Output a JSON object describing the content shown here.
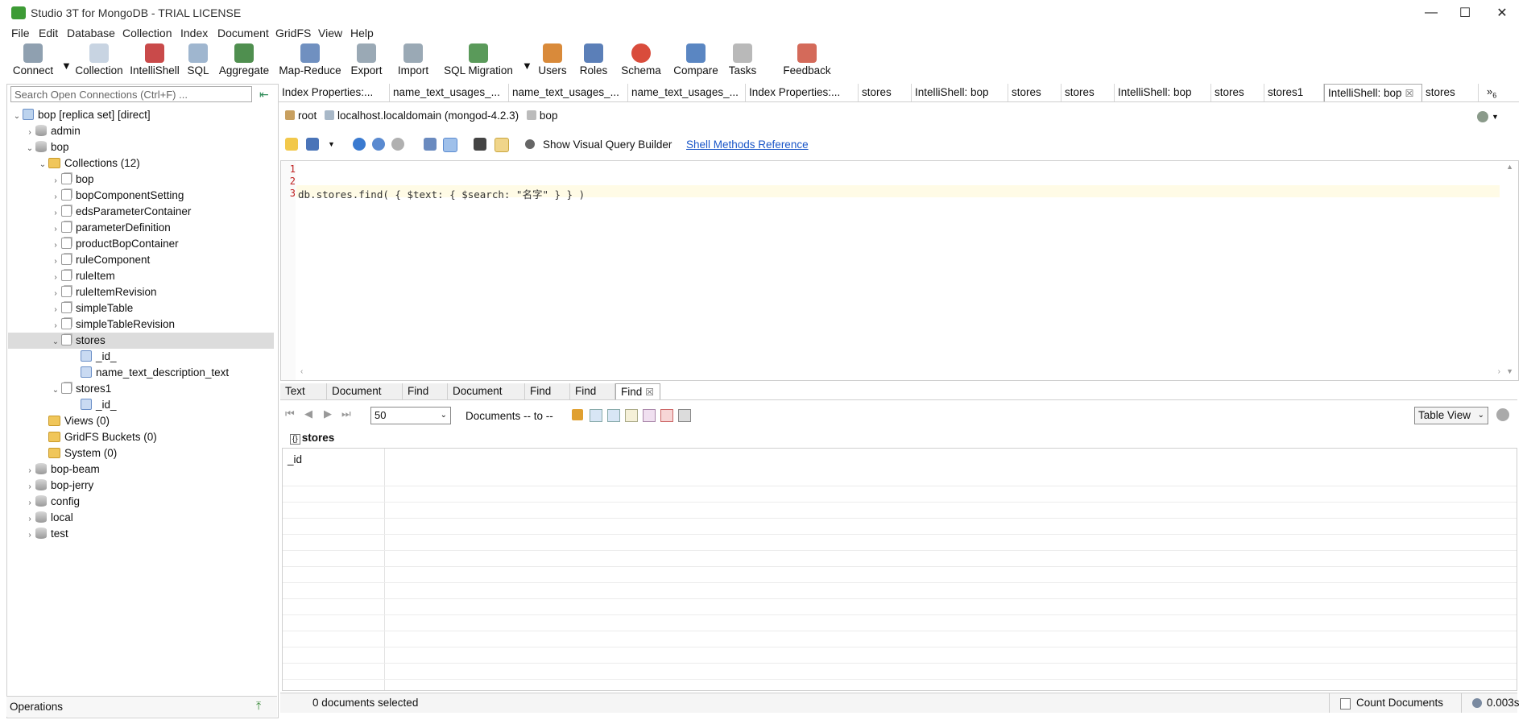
{
  "window": {
    "title": "Studio 3T for MongoDB - TRIAL LICENSE",
    "controls": {
      "minimize": "—",
      "maximize": "☐",
      "close": "✕"
    }
  },
  "menu": [
    "File",
    "Edit",
    "Database",
    "Collection",
    "Index",
    "Document",
    "GridFS",
    "View",
    "Help"
  ],
  "toolbar": [
    {
      "label": "Connect",
      "icon": "connect-icon",
      "color": "#8fa0b0"
    },
    {
      "label": "Collection",
      "icon": "collection-icon",
      "color": "#c8d4e2"
    },
    {
      "label": "IntelliShell",
      "icon": "intellishell-icon",
      "color": "#c94a4a"
    },
    {
      "label": "SQL",
      "icon": "sql-icon",
      "color": "#9fb6cf"
    },
    {
      "label": "Aggregate",
      "icon": "aggregate-icon",
      "color": "#4f8f4f"
    },
    {
      "label": "Map-Reduce",
      "icon": "map-reduce-icon",
      "color": "#7090c0"
    },
    {
      "label": "Export",
      "icon": "export-icon",
      "color": "#9aa9b5"
    },
    {
      "label": "Import",
      "icon": "import-icon",
      "color": "#9aa9b5"
    },
    {
      "label": "SQL Migration",
      "icon": "sql-migration-icon",
      "color": "#5a9a5a"
    },
    {
      "label": "Users",
      "icon": "users-icon",
      "color": "#d98a3a"
    },
    {
      "label": "Roles",
      "icon": "roles-icon",
      "color": "#5b7fb8"
    },
    {
      "label": "Schema",
      "icon": "schema-icon",
      "color": "#d94c3c"
    },
    {
      "label": "Compare",
      "icon": "compare-icon",
      "color": "#5a86c2"
    },
    {
      "label": "Tasks",
      "icon": "tasks-icon",
      "color": "#b9b9b9"
    },
    {
      "label": "Feedback",
      "icon": "feedback-icon",
      "color": "#d46a5a"
    }
  ],
  "search": {
    "placeholder": "Search Open Connections (Ctrl+F) ..."
  },
  "tree": [
    {
      "label": "bop [replica set] [direct]",
      "level": 0,
      "exp": "open",
      "icon": "srv"
    },
    {
      "label": "admin",
      "level": 1,
      "exp": "closed",
      "icon": "db"
    },
    {
      "label": "bop",
      "level": 1,
      "exp": "open",
      "icon": "db"
    },
    {
      "label": "Collections (12)",
      "level": 2,
      "exp": "open",
      "icon": "folder"
    },
    {
      "label": "bop",
      "level": 3,
      "exp": "closed",
      "icon": "coll"
    },
    {
      "label": "bopComponentSetting",
      "level": 3,
      "exp": "closed",
      "icon": "coll"
    },
    {
      "label": "edsParameterContainer",
      "level": 3,
      "exp": "closed",
      "icon": "coll"
    },
    {
      "label": "parameterDefinition",
      "level": 3,
      "exp": "closed",
      "icon": "coll"
    },
    {
      "label": "productBopContainer",
      "level": 3,
      "exp": "closed",
      "icon": "coll"
    },
    {
      "label": "ruleComponent",
      "level": 3,
      "exp": "closed",
      "icon": "coll"
    },
    {
      "label": "ruleItem",
      "level": 3,
      "exp": "closed",
      "icon": "coll"
    },
    {
      "label": "ruleItemRevision",
      "level": 3,
      "exp": "closed",
      "icon": "coll"
    },
    {
      "label": "simpleTable",
      "level": 3,
      "exp": "closed",
      "icon": "coll"
    },
    {
      "label": "simpleTableRevision",
      "level": 3,
      "exp": "closed",
      "icon": "coll"
    },
    {
      "label": "stores",
      "level": 3,
      "exp": "open",
      "icon": "coll",
      "selected": true
    },
    {
      "label": "_id_",
      "level": 4,
      "exp": "none",
      "icon": "idx"
    },
    {
      "label": "name_text_description_text",
      "level": 4,
      "exp": "none",
      "icon": "idx"
    },
    {
      "label": "stores1",
      "level": 3,
      "exp": "open",
      "icon": "coll"
    },
    {
      "label": "_id_",
      "level": 4,
      "exp": "none",
      "icon": "idx"
    },
    {
      "label": "Views (0)",
      "level": 2,
      "exp": "none",
      "icon": "folder"
    },
    {
      "label": "GridFS Buckets (0)",
      "level": 2,
      "exp": "none",
      "icon": "folder"
    },
    {
      "label": "System (0)",
      "level": 2,
      "exp": "none",
      "icon": "folder"
    },
    {
      "label": "bop-beam",
      "level": 1,
      "exp": "closed",
      "icon": "db"
    },
    {
      "label": "bop-jerry",
      "level": 1,
      "exp": "closed",
      "icon": "db"
    },
    {
      "label": "config",
      "level": 1,
      "exp": "closed",
      "icon": "db"
    },
    {
      "label": "local",
      "level": 1,
      "exp": "closed",
      "icon": "db"
    },
    {
      "label": "test",
      "level": 1,
      "exp": "closed",
      "icon": "db"
    }
  ],
  "operations": {
    "label": "Operations"
  },
  "tabs": [
    {
      "label": "Index Properties:..."
    },
    {
      "label": "name_text_usages_..."
    },
    {
      "label": "name_text_usages_..."
    },
    {
      "label": "name_text_usages_..."
    },
    {
      "label": "Index Properties:..."
    },
    {
      "label": "stores"
    },
    {
      "label": "IntelliShell: bop"
    },
    {
      "label": "stores"
    },
    {
      "label": "stores"
    },
    {
      "label": "IntelliShell: bop"
    },
    {
      "label": "stores"
    },
    {
      "label": "stores1"
    },
    {
      "label": "IntelliShell: bop",
      "active": true,
      "close": "☒"
    },
    {
      "label": "stores"
    }
  ],
  "tabs_overflow": {
    "label": "»",
    "count": "6"
  },
  "breadcrumb": {
    "user": "root",
    "host": "localhost.localdomain (mongod-4.2.3)",
    "db": "bop"
  },
  "shell_toolbar": {
    "visual_query": "Show Visual Query Builder",
    "methods_link": "Shell Methods Reference"
  },
  "editor": {
    "lines": [
      {
        "n": "1",
        "text": ""
      },
      {
        "n": "2",
        "text": ""
      },
      {
        "n": "3",
        "text": "db.stores.find( { $text: { $search: \"名字\" } } )"
      }
    ]
  },
  "result_tabs": [
    {
      "label": "Text"
    },
    {
      "label": "Document"
    },
    {
      "label": "Find"
    },
    {
      "label": "Document"
    },
    {
      "label": "Find"
    },
    {
      "label": "Find"
    },
    {
      "label": "Find",
      "active": true,
      "close": "☒"
    }
  ],
  "result_toolbar": {
    "page_size": "50",
    "range": "Documents -- to --",
    "view_mode": "Table View"
  },
  "result": {
    "collection": "stores",
    "columns": [
      "_id"
    ]
  },
  "status": {
    "selected": "0 documents selected",
    "count_btn": "Count Documents",
    "time": "0.003s"
  },
  "colors": {
    "accent": "#1a56c8",
    "selection": "#dcdcdc",
    "line_highlight": "#fffbe6"
  }
}
